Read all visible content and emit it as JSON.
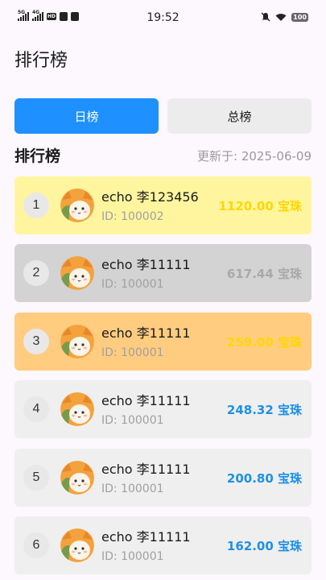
{
  "status_bar": {
    "time": "19:52",
    "sig1_label": "5G",
    "sig2_label": "4G",
    "hd_label": "HD",
    "battery": "100",
    "icons": [
      "signal-5g-icon",
      "signal-4g-icon",
      "hd-icon",
      "clipboard-icon",
      "app-icon",
      "mute-icon",
      "wifi-icon",
      "battery-icon"
    ]
  },
  "page": {
    "title": "排行榜"
  },
  "tabs": [
    {
      "label": "日榜",
      "active": true
    },
    {
      "label": "总榜",
      "active": false
    }
  ],
  "section": {
    "title": "排行榜",
    "updated": "更新于: 2025-06-09"
  },
  "colors": {
    "accent": "#1e90ff",
    "gold_bg": "#fff59f",
    "gold_score": "#ffd700",
    "silver_bg": "#d3d3d3",
    "silver_score": "#a9a9a9",
    "bronze_bg": "#ffcc80",
    "bronze_score": "#ffd700",
    "normal_bg": "#efefef",
    "normal_score": "#1e90e6"
  },
  "leaderboard": [
    {
      "rank": "1",
      "name": "echo 李123456",
      "uid": "ID: 100002",
      "score": "1120.00 宝珠",
      "tier": "gold"
    },
    {
      "rank": "2",
      "name": "echo 李11111",
      "uid": "ID: 100001",
      "score": "617.44 宝珠",
      "tier": "silver"
    },
    {
      "rank": "3",
      "name": "echo 李11111",
      "uid": "ID: 100001",
      "score": "259.00 宝珠",
      "tier": "bronze"
    },
    {
      "rank": "4",
      "name": "echo 李11111",
      "uid": "ID: 100001",
      "score": "248.32 宝珠",
      "tier": "normal"
    },
    {
      "rank": "5",
      "name": "echo 李11111",
      "uid": "ID: 100001",
      "score": "200.80 宝珠",
      "tier": "normal"
    },
    {
      "rank": "6",
      "name": "echo 李11111",
      "uid": "ID: 100001",
      "score": "162.00 宝珠",
      "tier": "normal"
    }
  ]
}
